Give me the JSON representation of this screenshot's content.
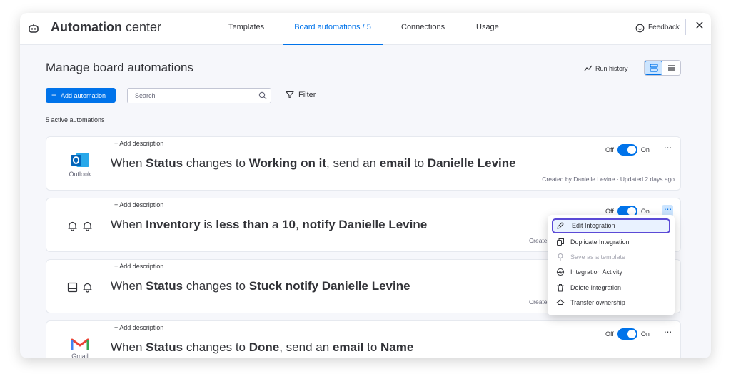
{
  "header": {
    "title_bold": "Automation",
    "title_rest": " center",
    "tabs": [
      {
        "label": "Templates"
      },
      {
        "label": "Board automations / 5"
      },
      {
        "label": "Connections"
      },
      {
        "label": "Usage"
      }
    ],
    "feedback_label": "Feedback",
    "close_label": "✕"
  },
  "main": {
    "page_title": "Manage board automations",
    "run_history_label": "Run history",
    "add_automation_label": "Add automation",
    "search_placeholder": "Search",
    "filter_label": "Filter",
    "active_count": "5 active automations"
  },
  "automations": [
    {
      "add_description": "+ Add description",
      "icon_label": "Outlook",
      "s": [
        "When ",
        "Status",
        " changes to ",
        "Working on it",
        ", send an ",
        "email",
        " to ",
        "Danielle Levine"
      ],
      "meta": "Created by Danielle Levine · Updated 2 days ago",
      "off_label": "Off",
      "on_label": "On"
    },
    {
      "add_description": "+ Add description",
      "s": [
        "When ",
        "Inventory",
        " is ",
        "less than",
        " a ",
        "10",
        ", ",
        "notify",
        " ",
        "Danielle Levine"
      ],
      "meta": "Create",
      "off_label": "Off",
      "on_label": "On"
    },
    {
      "add_description": "+ Add description",
      "s": [
        "When ",
        "Status",
        " changes to ",
        "Stuck",
        " ",
        "notify",
        " ",
        "Danielle Levine"
      ],
      "meta": "Create"
    },
    {
      "add_description": "+ Add description",
      "icon_label": "Gmail",
      "s": [
        "When ",
        "Status",
        " changes to ",
        "Done",
        ", send an ",
        "email",
        " to ",
        "Name"
      ],
      "off_label": "Off",
      "on_label": "On"
    }
  ],
  "context_menu": {
    "items": [
      {
        "label": "Edit Integration",
        "icon": "pencil-icon"
      },
      {
        "label": "Duplicate Integration",
        "icon": "duplicate-icon"
      },
      {
        "label": "Save as a template",
        "icon": "template-icon"
      },
      {
        "label": "Integration Activity",
        "icon": "activity-icon"
      },
      {
        "label": "Delete Integration",
        "icon": "trash-icon"
      },
      {
        "label": "Transfer ownership",
        "icon": "transfer-icon"
      }
    ]
  },
  "colors": {
    "accent": "#0073ea",
    "highlight_border": "#5b4ad6",
    "outlook_blue": "#0364b8",
    "gmail_red": "#ea4335"
  }
}
